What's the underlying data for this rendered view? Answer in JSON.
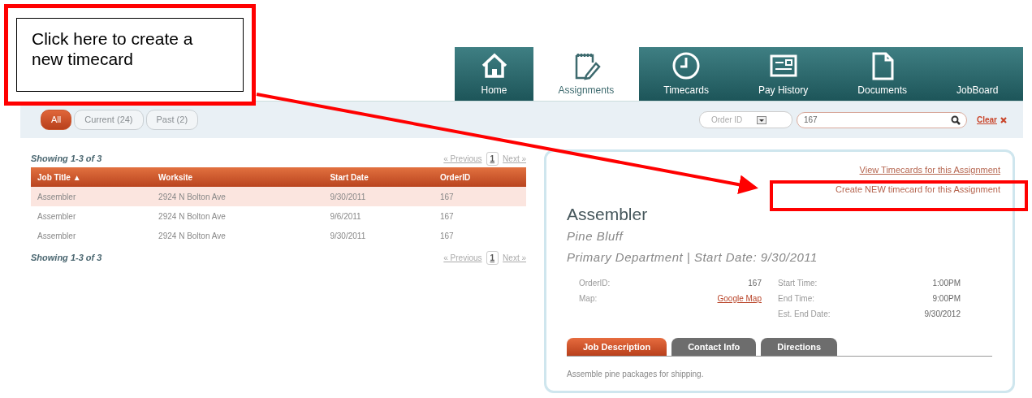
{
  "annotation": {
    "callout_text": "Click here to create a new timecard"
  },
  "nav": [
    {
      "label": "Home",
      "selected": false
    },
    {
      "label": "Assignments",
      "selected": true
    },
    {
      "label": "Timecards",
      "selected": false
    },
    {
      "label": "Pay History",
      "selected": false
    },
    {
      "label": "Documents",
      "selected": false
    },
    {
      "label": "JobBoard",
      "selected": false
    }
  ],
  "filters": [
    {
      "label": "All",
      "selected": true
    },
    {
      "label": "Current (24)",
      "selected": false
    },
    {
      "label": "Past (2)",
      "selected": false
    }
  ],
  "search": {
    "field": "Order ID",
    "value": "167",
    "clear": "Clear"
  },
  "pager_top": {
    "summary": "Showing 1-3 of 3",
    "previous": "« Previous",
    "page": "1",
    "next": "Next »"
  },
  "table": {
    "columns": [
      "Job Title ▲",
      "Worksite",
      "Start Date",
      "OrderID"
    ],
    "rows": [
      {
        "cells": [
          "Assembler",
          "2924 N Bolton Ave",
          "9/30/2011",
          "167"
        ],
        "selected": true
      },
      {
        "cells": [
          "Assembler",
          "2924 N Bolton Ave",
          "9/6/2011",
          "167"
        ],
        "selected": false
      },
      {
        "cells": [
          "Assembler",
          "2924 N Bolton Ave",
          "9/30/2011",
          "167"
        ],
        "selected": false
      }
    ]
  },
  "pager_bottom": {
    "summary": "Showing 1-3 of 3",
    "previous": "« Previous",
    "page": "1",
    "next": "Next »"
  },
  "detail": {
    "links": [
      "View Timecards for this Assignment",
      "Create NEW timecard for this Assignment"
    ],
    "title": "Assembler",
    "location": "Pine Bluff",
    "subtitle": "Primary Department | Start Date: 9/30/2011",
    "fields_left": [
      {
        "label": "OrderID:",
        "value": "167",
        "kind": "text"
      },
      {
        "label": "Map:",
        "value": "Google Map",
        "kind": "link"
      }
    ],
    "fields_right": [
      {
        "label": "Start Time:",
        "value": "1:00PM",
        "kind": "text"
      },
      {
        "label": "End Time:",
        "value": "9:00PM",
        "kind": "text"
      },
      {
        "label": "Est. End Date:",
        "value": "9/30/2012",
        "kind": "text"
      }
    ],
    "tabs": [
      {
        "label": "Job Description",
        "selected": true
      },
      {
        "label": "Contact Info",
        "selected": false
      },
      {
        "label": "Directions",
        "selected": false
      }
    ],
    "description": "Assemble pine packages for shipping."
  }
}
